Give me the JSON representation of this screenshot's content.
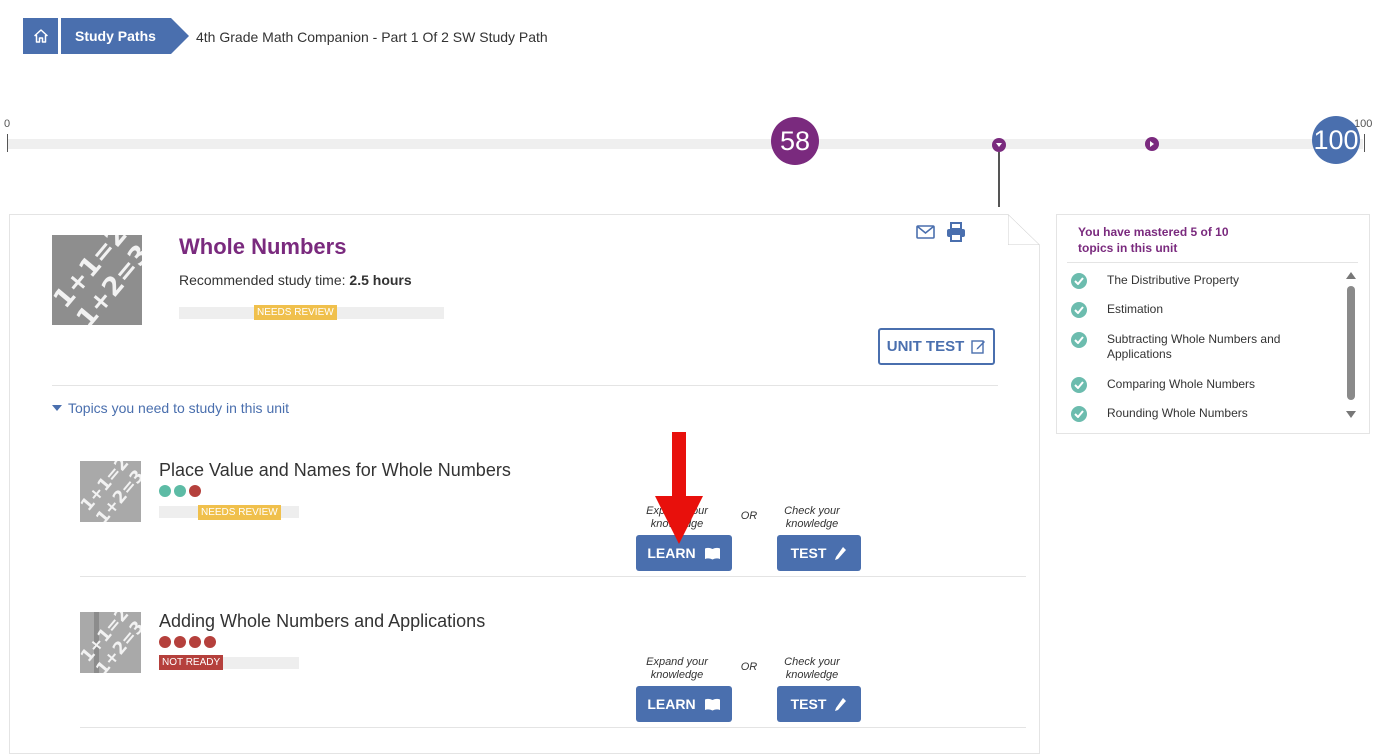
{
  "breadcrumb": {
    "home_icon": "home-icon",
    "study_paths": "Study Paths",
    "current": "4th Grade Math Companion - Part 1 Of 2 SW Study Path"
  },
  "progress": {
    "min_label": "0",
    "max_label": "100",
    "current_score": "58",
    "target_score": "100",
    "current_value": 58,
    "target_value": 100
  },
  "unit": {
    "title": "Whole Numbers",
    "study_time_label": "Recommended study time:",
    "study_time_value": "2.5 hours",
    "status": "NEEDS REVIEW",
    "unit_test_label": "UNIT TEST",
    "email_icon": "email-icon",
    "print_icon": "print-icon"
  },
  "topics_section": {
    "toggle_label": "Topics you need to study in this unit",
    "topics": [
      {
        "title": "Place Value and Names for Whole Numbers",
        "status": "NEEDS REVIEW",
        "dots": [
          "#5dbba5",
          "#5dbba5",
          "#b5403c"
        ],
        "learn_note": "Expand your knowledge",
        "or_label": "OR",
        "test_note": "Check your knowledge",
        "learn_label": "LEARN",
        "test_label": "TEST"
      },
      {
        "title": "Adding Whole Numbers and Applications",
        "status": "NOT READY",
        "dots": [
          "#b5403c",
          "#b5403c",
          "#b5403c",
          "#b5403c"
        ],
        "learn_note": "Expand your knowledge",
        "or_label": "OR",
        "test_note": "Check your knowledge",
        "learn_label": "LEARN",
        "test_label": "TEST"
      }
    ]
  },
  "mastery": {
    "heading_line1": "You have mastered 5 of 10",
    "heading_line2": "topics in this unit",
    "items": [
      "The Distributive Property",
      "Estimation",
      "Subtracting Whole Numbers and Applications",
      "Comparing Whole Numbers",
      "Rounding Whole Numbers"
    ]
  },
  "colors": {
    "brand_blue": "#4a6fae",
    "purple": "#7a2a7e",
    "needs_review": "#f0c04c",
    "not_ready": "#b5403c",
    "mastered": "#6cbcae"
  }
}
